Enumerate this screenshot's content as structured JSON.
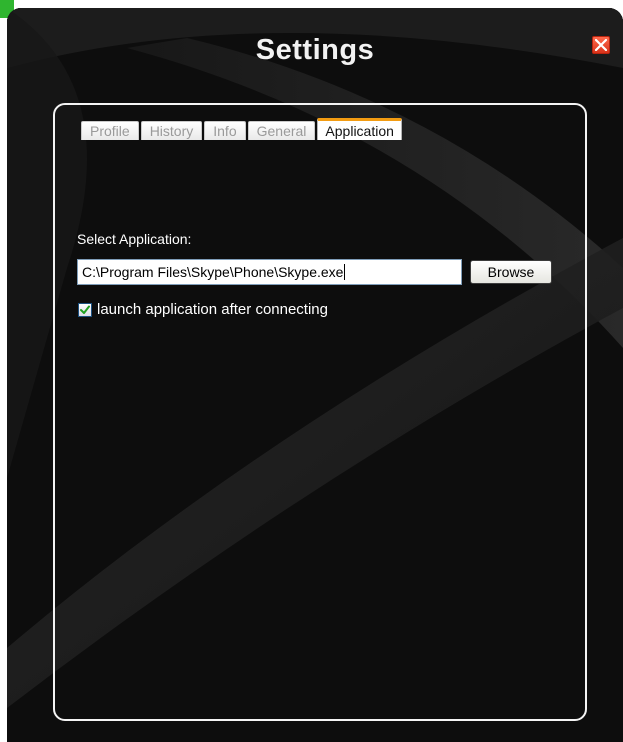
{
  "window": {
    "title": "Settings"
  },
  "tabs": [
    {
      "label": "Profile",
      "active": false
    },
    {
      "label": "History",
      "active": false
    },
    {
      "label": "Info",
      "active": false
    },
    {
      "label": "General",
      "active": false
    },
    {
      "label": "Application",
      "active": true
    }
  ],
  "application": {
    "select_label": "Select Application:",
    "path_value": "C:\\Program Files\\Skype\\Phone\\Skype.exe",
    "browse_label": "Browse",
    "launch_checkbox_label": "launch application after connecting",
    "launch_checkbox_checked": true
  },
  "icons": {
    "close": "close-icon",
    "check": "checkmark-icon"
  },
  "colors": {
    "active_tab_accent": "#f39c12",
    "close_button": "#e8452a",
    "window_background": "#0c0c0c"
  }
}
